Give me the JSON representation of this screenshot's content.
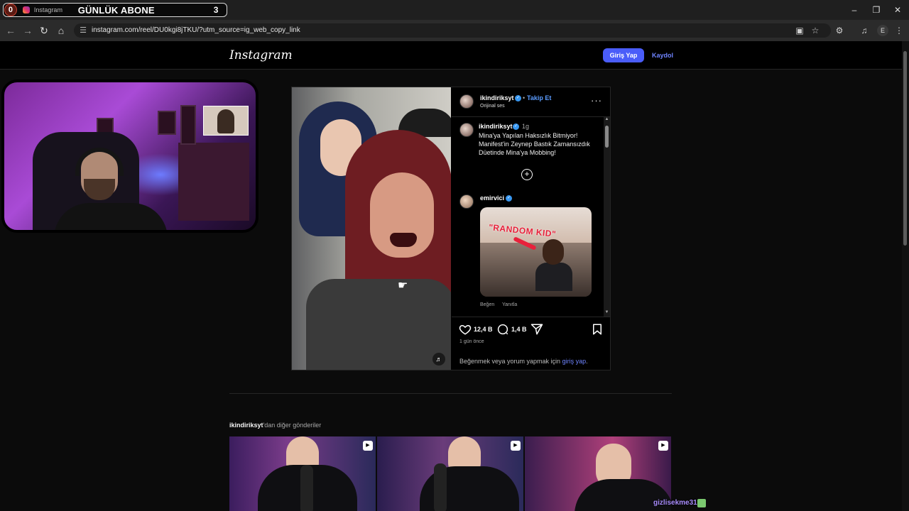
{
  "browser": {
    "tab_left_count": "0",
    "tab_title": "Instagram",
    "tab_overlay_text": "GÜNLÜK ABONE",
    "tab_right_count": "3",
    "url": "instagram.com/reel/DU0kgi8jTKU/?utm_source=ig_web_copy_link",
    "profile_initial": "E",
    "icons": [
      "back-icon",
      "forward-icon",
      "reload-icon",
      "home-icon",
      "site-info-icon",
      "install-icon",
      "star-icon",
      "extensions-icon",
      "media-icon",
      "more-vert-icon"
    ]
  },
  "header": {
    "logo": "Instagram",
    "login_label": "Giriş Yap",
    "signup_label": "Kaydol"
  },
  "post": {
    "username": "ikindiriksyt",
    "dot": "•",
    "follow_label": "Takip Et",
    "audio": "Orijinal ses",
    "more_label": "···",
    "caption_user": "ikindiriksyt",
    "caption_time": "1g",
    "caption": "Mina'ya Yapılan Haksızlık Bitmiyor! Manifest'in Zeynep Bastık Zamansızdık Düetinde Mina'ya Mobbing!",
    "add_label": "+",
    "comment_user": "emirvici",
    "comment_image_text": "\"RANDOM KID\"",
    "comment_like_label": "Beğen",
    "comment_reply_label": "Yanıtla",
    "likes": "12,4 B",
    "comments": "1,4 B",
    "posted": "1 gün önce",
    "login_prompt_prefix": "Beğenmek veya yorum yapmak için ",
    "login_prompt_link": "giriş yap",
    "login_prompt_suffix": "."
  },
  "more_posts": {
    "user": "ikindiriksyt",
    "suffix": "'dan diğer gönderiler"
  },
  "overlay": {
    "chat_message": "gizlisekme31:"
  },
  "colors": {
    "accent": "#4a5df9",
    "link": "#6f84ff",
    "verified": "#3897f0",
    "background": "#0b0b0b"
  }
}
